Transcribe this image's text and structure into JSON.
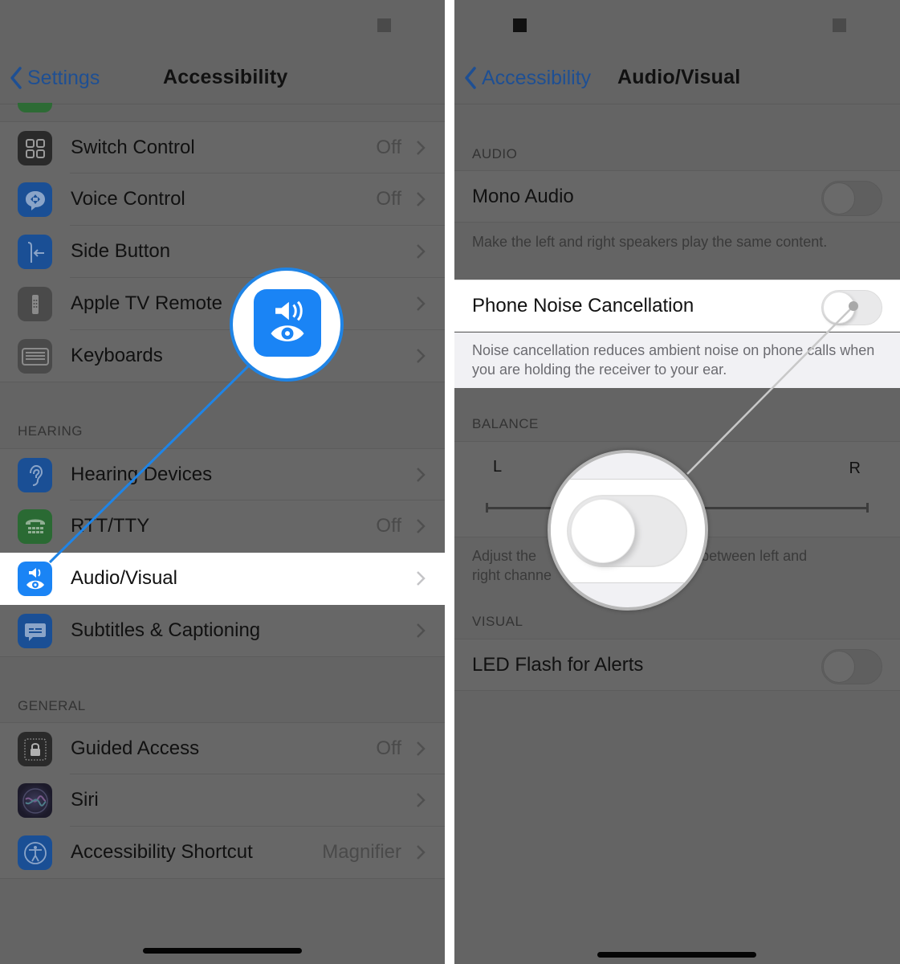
{
  "left": {
    "nav": {
      "back_label": "Settings",
      "title": "Accessibility"
    },
    "rows_top": [
      {
        "label": "Switch Control",
        "value": "Off",
        "icon": "switch-control-icon",
        "color": "#2a2a2a"
      },
      {
        "label": "Voice Control",
        "value": "Off",
        "icon": "voice-control-icon",
        "color": "#1a4f95"
      },
      {
        "label": "Side Button",
        "value": "",
        "icon": "side-button-icon",
        "color": "#1a4f95"
      },
      {
        "label": "Apple TV Remote",
        "value": "",
        "icon": "tv-remote-icon",
        "color": "#4a4a4a"
      },
      {
        "label": "Keyboards",
        "value": "",
        "icon": "keyboard-icon",
        "color": "#4a4a4a"
      }
    ],
    "hearing_header": "HEARING",
    "rows_hearing": [
      {
        "label": "Hearing Devices",
        "value": "",
        "icon": "ear-icon",
        "color": "#1a4f95"
      },
      {
        "label": "RTT/TTY",
        "value": "Off",
        "icon": "tty-phone-icon",
        "color": "#2a6a33"
      },
      {
        "label": "Audio/Visual",
        "value": "",
        "icon": "audio-visual-icon",
        "color": "#1a84f5",
        "highlighted": true
      },
      {
        "label": "Subtitles & Captioning",
        "value": "",
        "icon": "subtitles-icon",
        "color": "#1a4f95"
      }
    ],
    "general_header": "GENERAL",
    "rows_general": [
      {
        "label": "Guided Access",
        "value": "Off",
        "icon": "lock-icon",
        "color": "#2a2a2a"
      },
      {
        "label": "Siri",
        "value": "",
        "icon": "siri-icon",
        "color": "#1a1a2a"
      },
      {
        "label": "Accessibility Shortcut",
        "value": "Magnifier",
        "icon": "accessibility-icon",
        "color": "#1a4f95"
      }
    ],
    "magnifier_icon": "audio-visual-icon",
    "accent": "#1a84f5"
  },
  "right": {
    "nav": {
      "back_label": "Accessibility",
      "title": "Audio/Visual"
    },
    "audio_header": "AUDIO",
    "mono_audio": {
      "label": "Mono Audio",
      "on": false
    },
    "mono_footer": "Make the left and right speakers play the same content.",
    "noise_cancel": {
      "label": "Phone Noise Cancellation",
      "on": false
    },
    "noise_footer": "Noise cancellation reduces ambient noise on phone calls when you are holding the receiver to your ear.",
    "balance_header": "BALANCE",
    "balance": {
      "left_label": "L",
      "right_label": "R"
    },
    "balance_footer_a": "Adjust the",
    "balance_footer_b": "between left and",
    "balance_footer_c": "right channe",
    "visual_header": "VISUAL",
    "led_flash": {
      "label": "LED Flash for Alerts",
      "on": false
    }
  }
}
